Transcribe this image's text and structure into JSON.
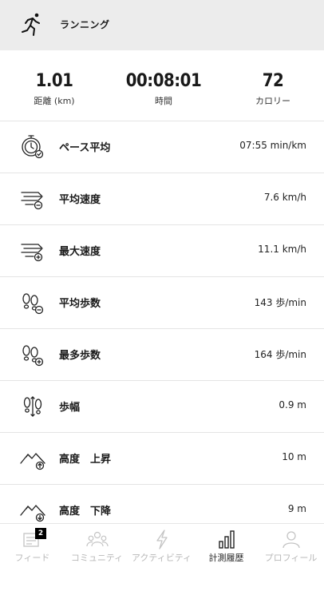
{
  "header": {
    "title": "ランニング",
    "icon": "runner-icon"
  },
  "summary": [
    {
      "value": "1.01",
      "label": "距離 (km)"
    },
    {
      "value": "00:08:01",
      "label": "時間"
    },
    {
      "value": "72",
      "label": "カロリー"
    }
  ],
  "metrics": [
    {
      "label": "ペース平均",
      "value": "07:55 min/km",
      "icon": "stopwatch-icon"
    },
    {
      "label": "平均速度",
      "value": "7.6 km/h",
      "icon": "speed-average-icon"
    },
    {
      "label": "最大速度",
      "value": "11.1 km/h",
      "icon": "speed-max-icon"
    },
    {
      "label": "平均歩数",
      "value": "143 歩/min",
      "icon": "footsteps-average-icon"
    },
    {
      "label": "最多歩数",
      "value": "164 歩/min",
      "icon": "footsteps-max-icon"
    },
    {
      "label": "歩幅",
      "value": "0.9 m",
      "icon": "stride-icon"
    },
    {
      "label": "高度　上昇",
      "value": "10 m",
      "icon": "elevation-up-icon"
    },
    {
      "label": "高度　下降",
      "value": "9 m",
      "icon": "elevation-down-icon"
    }
  ],
  "tabs": [
    {
      "label": "フィード",
      "icon": "feed-icon",
      "badge": "2"
    },
    {
      "label": "コミュニティ",
      "icon": "community-icon"
    },
    {
      "label": "アクティビティ",
      "icon": "activity-bolt-icon"
    },
    {
      "label": "計測履歴",
      "icon": "history-bars-icon",
      "active": true
    },
    {
      "label": "プロフィール",
      "icon": "profile-icon"
    }
  ]
}
